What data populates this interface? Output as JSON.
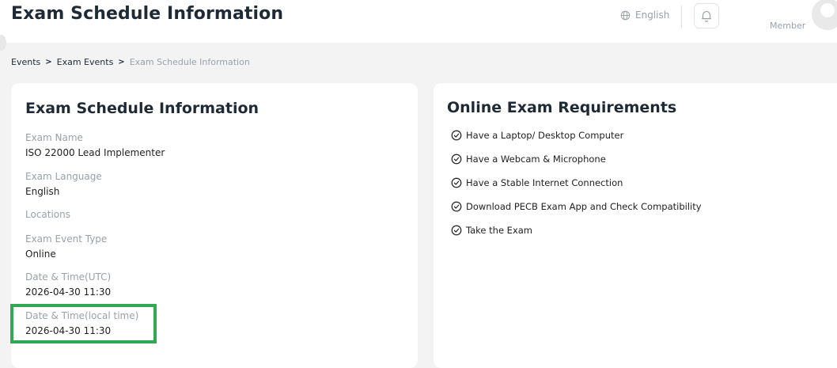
{
  "header": {
    "title": "Exam Schedule Information",
    "language": "English",
    "member_label": "Member"
  },
  "breadcrumb": {
    "items": [
      "Events",
      "Exam Events",
      "Exam Schedule Information"
    ]
  },
  "schedule_card": {
    "title": "Exam Schedule Information",
    "fields": [
      {
        "label": "Exam Name",
        "value": "ISO 22000 Lead Implementer"
      },
      {
        "label": "Exam Language",
        "value": "English"
      },
      {
        "label": "Locations",
        "value": ""
      },
      {
        "label": "Exam Event Type",
        "value": "Online"
      },
      {
        "label": "Date & Time(UTC)",
        "value": "2026-04-30 11:30"
      },
      {
        "label": "Date & Time(local time)",
        "value": "2026-04-30 11:30"
      }
    ]
  },
  "requirements_card": {
    "title": "Online Exam Requirements",
    "items": [
      "Have a Laptop/ Desktop Computer",
      "Have a Webcam & Microphone",
      "Have a Stable Internet Connection",
      "Download PECB Exam App and Check Compatibility",
      "Take the Exam"
    ]
  },
  "colors": {
    "highlight": "#32a852",
    "muted_text": "#9aa1a9",
    "heading": "#1f2a37"
  },
  "icons": {
    "language": "globe-icon",
    "notifications": "bell-icon",
    "requirement": "check-circle-icon",
    "breadcrumb_separator": "chevron-right-icon"
  }
}
